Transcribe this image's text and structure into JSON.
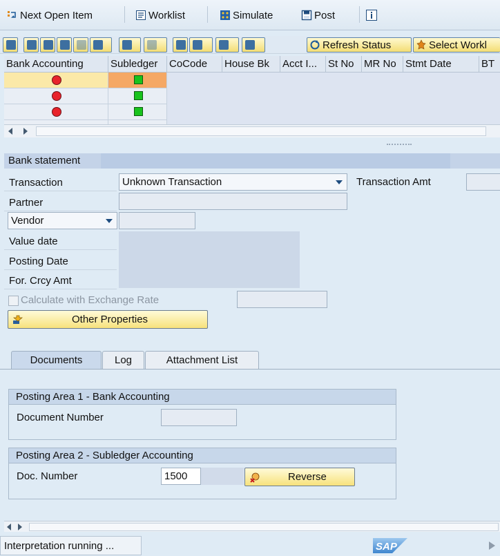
{
  "toolbar": {
    "next_open_item": "Next Open Item",
    "worklist": "Worklist",
    "simulate": "Simulate",
    "post": "Post"
  },
  "grid_toolbar": {
    "refresh_status": "Refresh Status",
    "select_worklist": "Select Workl"
  },
  "table": {
    "columns": [
      "Bank Accounting",
      "Subledger",
      "CoCode",
      "House Bk",
      "Acct I...",
      "St No",
      "MR No",
      "Stmt Date",
      "BT"
    ],
    "rows": [
      {
        "bank_accounting": "red",
        "subledger": "green",
        "selected": true
      },
      {
        "bank_accounting": "red",
        "subledger": "green",
        "selected": false
      },
      {
        "bank_accounting": "red",
        "subledger": "green",
        "selected": false
      }
    ]
  },
  "bank_statement": {
    "header": "Bank statement",
    "transaction_label": "Transaction",
    "transaction_value": "Unknown Transaction",
    "transaction_amt_label": "Transaction Amt",
    "partner_label": "Partner",
    "partner_type": "Vendor",
    "value_date_label": "Value date",
    "posting_date_label": "Posting Date",
    "for_crcy_amt_label": "For. Crcy Amt",
    "calc_exchange_rate_label": "Calculate with Exchange Rate",
    "other_properties": "Other Properties"
  },
  "tabs": [
    {
      "label": "Documents",
      "active": true
    },
    {
      "label": "Log",
      "active": false
    },
    {
      "label": "Attachment List",
      "active": false
    }
  ],
  "posting_area_1": {
    "title": "Posting Area 1 - Bank Accounting",
    "doc_number_label": "Document Number",
    "doc_number_value": ""
  },
  "posting_area_2": {
    "title": "Posting Area 2 - Subledger Accounting",
    "doc_number_label": "Doc. Number",
    "doc_number_value": "1500",
    "reverse": "Reverse"
  },
  "status": {
    "text": "Interpretation running ...",
    "logo": "SAP"
  },
  "colors": {
    "background": "#dfebf5",
    "selected_row": "#fbe9a8",
    "selected_cell": "#f5a865",
    "status_red": "#e8232b",
    "status_green": "#19c31d",
    "button_yellow": "#f7e27c",
    "sap_blue": "#1b6fc5"
  }
}
